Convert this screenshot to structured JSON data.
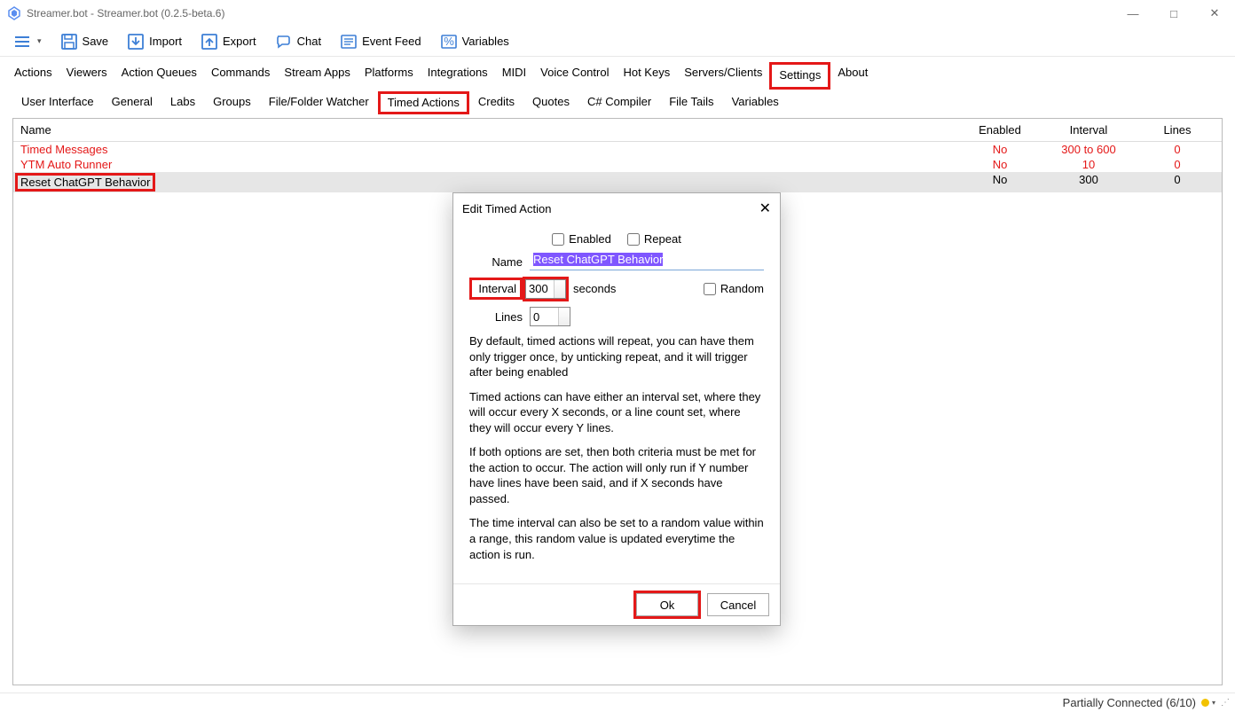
{
  "window": {
    "title": "Streamer.bot - Streamer.bot (0.2.5-beta.6)"
  },
  "toolbar": {
    "save": "Save",
    "import": "Import",
    "export": "Export",
    "chat": "Chat",
    "eventfeed": "Event Feed",
    "variables": "Variables"
  },
  "tabs": [
    "Actions",
    "Viewers",
    "Action Queues",
    "Commands",
    "Stream Apps",
    "Platforms",
    "Integrations",
    "MIDI",
    "Voice Control",
    "Hot Keys",
    "Servers/Clients",
    "Settings",
    "About"
  ],
  "subtabs": [
    "User Interface",
    "General",
    "Labs",
    "Groups",
    "File/Folder Watcher",
    "Timed Actions",
    "Credits",
    "Quotes",
    "C# Compiler",
    "File Tails",
    "Variables"
  ],
  "table": {
    "headers": {
      "name": "Name",
      "enabled": "Enabled",
      "interval": "Interval",
      "lines": "Lines"
    },
    "rows": [
      {
        "name": "Timed Messages",
        "enabled": "No",
        "interval": "300 to 600",
        "lines": "0",
        "red": true
      },
      {
        "name": "YTM Auto Runner",
        "enabled": "No",
        "interval": "10",
        "lines": "0",
        "red": true
      },
      {
        "name": "Reset ChatGPT Behavior",
        "enabled": "No",
        "interval": "300",
        "lines": "0",
        "selected": true
      }
    ]
  },
  "dialog": {
    "title": "Edit Timed Action",
    "enabled_label": "Enabled",
    "repeat_label": "Repeat",
    "name_label": "Name",
    "name_value": "Reset ChatGPT Behavior",
    "interval_label": "Interval",
    "interval_value": "300",
    "interval_unit": "seconds",
    "random_label": "Random",
    "lines_label": "Lines",
    "lines_value": "0",
    "help1": "By default, timed actions will repeat, you can have them only trigger once, by unticking repeat, and it will trigger after being enabled",
    "help2": "Timed actions can have either an interval set, where they will occur every X seconds, or a line count set, where they will occur every Y lines.",
    "help3": "If both options are set, then both criteria must be met for the action to occur.   The action will only run if Y number have lines have been said, and if X seconds have passed.",
    "help4": "The time interval can also be set to a random value within a range, this random value is updated everytime the action is run.",
    "ok": "Ok",
    "cancel": "Cancel"
  },
  "status": {
    "text": "Partially Connected (6/10)"
  }
}
